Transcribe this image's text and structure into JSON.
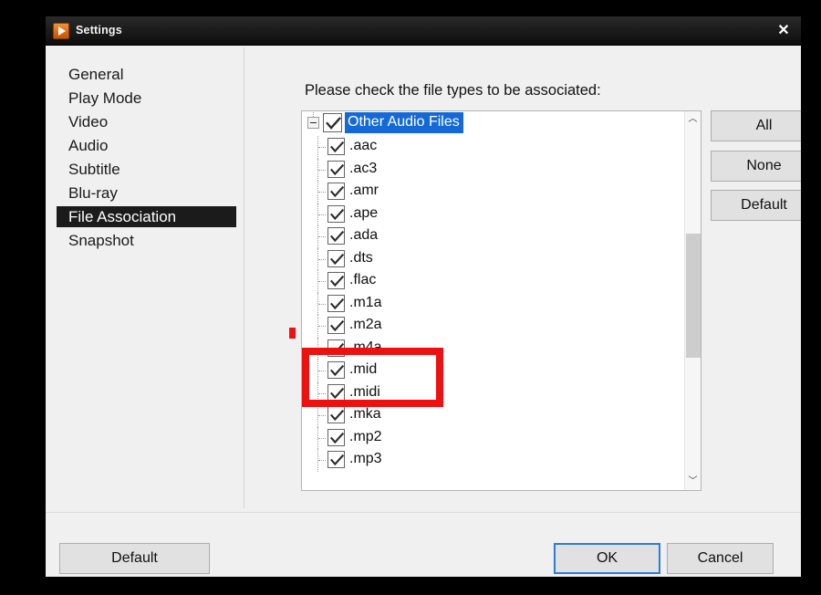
{
  "window": {
    "title": "Settings",
    "icon": "play-icon",
    "close_label": "✕"
  },
  "sidebar": {
    "items": [
      {
        "label": "General",
        "selected": false
      },
      {
        "label": "Play Mode",
        "selected": false
      },
      {
        "label": "Video",
        "selected": false
      },
      {
        "label": "Audio",
        "selected": false
      },
      {
        "label": "Subtitle",
        "selected": false
      },
      {
        "label": "Blu-ray",
        "selected": false
      },
      {
        "label": "File Association",
        "selected": true
      },
      {
        "label": "Snapshot",
        "selected": false
      }
    ]
  },
  "pane": {
    "instruction": "Please check the file types to be associated:",
    "tree": {
      "root": {
        "label": "Other Audio Files",
        "checked": true,
        "expanded": true,
        "selected": true
      },
      "children": [
        {
          "label": ".aac",
          "checked": true
        },
        {
          "label": ".ac3",
          "checked": true
        },
        {
          "label": ".amr",
          "checked": true
        },
        {
          "label": ".ape",
          "checked": true
        },
        {
          "label": ".ada",
          "checked": true
        },
        {
          "label": ".dts",
          "checked": true
        },
        {
          "label": ".flac",
          "checked": true
        },
        {
          "label": ".m1a",
          "checked": true
        },
        {
          "label": ".m2a",
          "checked": true
        },
        {
          "label": ".m4a",
          "checked": true
        },
        {
          "label": ".mid",
          "checked": true
        },
        {
          "label": ".midi",
          "checked": true
        },
        {
          "label": ".mka",
          "checked": true
        },
        {
          "label": ".mp2",
          "checked": true
        },
        {
          "label": ".mp3",
          "checked": true
        }
      ]
    },
    "scrollbar": {
      "up_arrow": "︿",
      "down_arrow": "﹀"
    },
    "buttons": {
      "all": "All",
      "none": "None",
      "default": "Default"
    }
  },
  "footer": {
    "default": "Default",
    "ok": "OK",
    "cancel": "Cancel"
  },
  "annotations": {
    "highlight_color": "#ee1111",
    "highlighted_items": [
      ".mid",
      ".midi"
    ]
  },
  "colors": {
    "selection_blue": "#1569d6",
    "sidebar_selected_bg": "#1b1b1b",
    "accent_orange": "#e06b11",
    "focus_border": "#2a7fd4"
  }
}
